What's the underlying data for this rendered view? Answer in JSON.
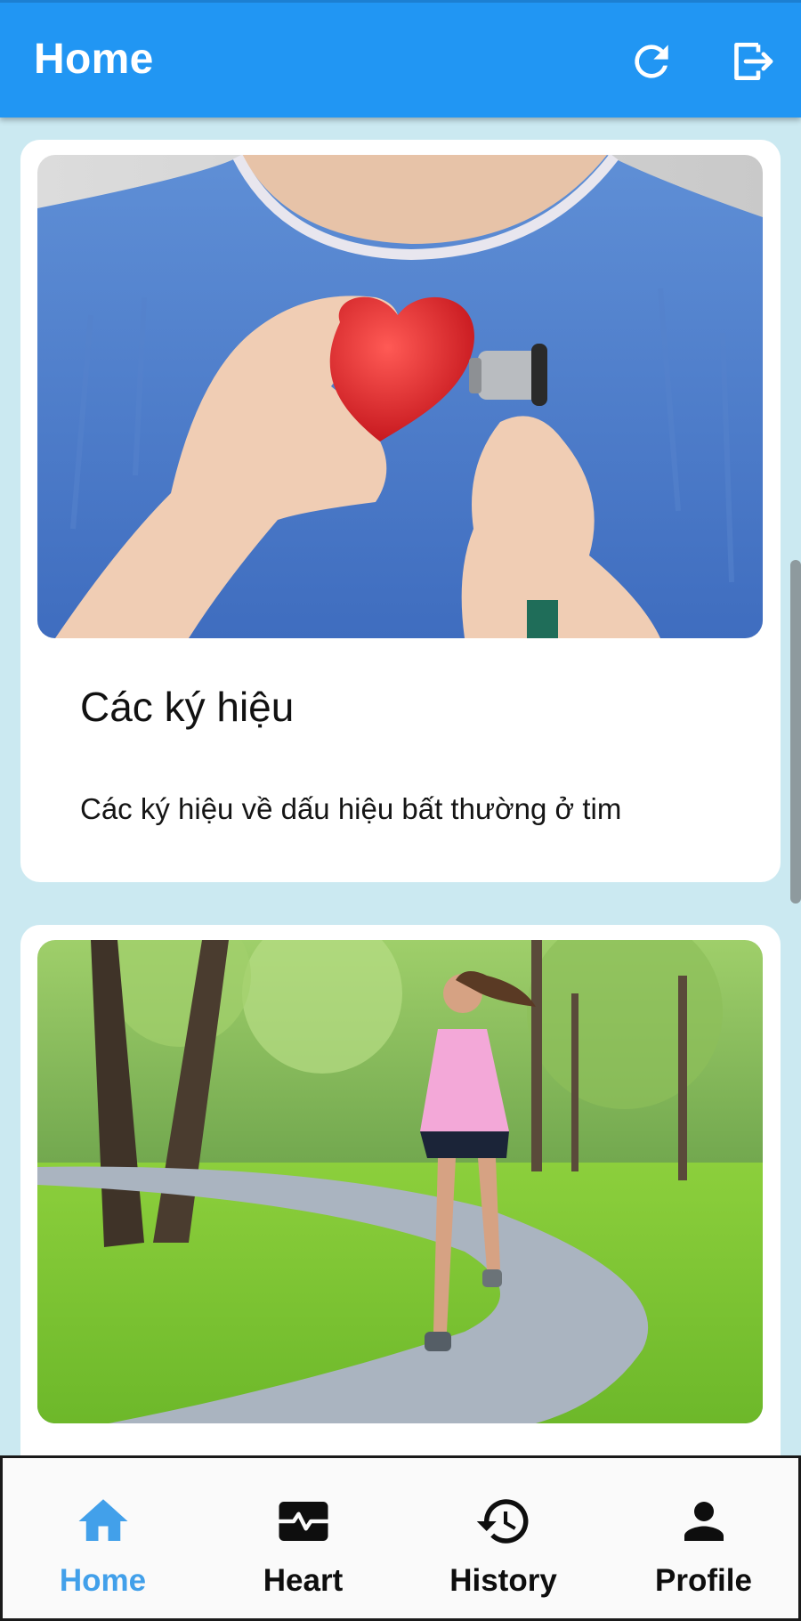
{
  "app_bar": {
    "title": "Home",
    "refresh_icon": "refresh-icon",
    "logout_icon": "logout-icon"
  },
  "cards": [
    {
      "image": "heart-stethoscope-photo",
      "title": "Các ký hiệu",
      "description": "Các ký hiệu về dấu hiệu bất thường ở tim"
    },
    {
      "image": "woman-running-in-park-photo"
    }
  ],
  "bottom_nav": {
    "items": [
      {
        "label": "Home",
        "icon": "home-icon",
        "active": true
      },
      {
        "label": "Heart",
        "icon": "heart-monitor-icon",
        "active": false
      },
      {
        "label": "History",
        "icon": "history-icon",
        "active": false
      },
      {
        "label": "Profile",
        "icon": "person-icon",
        "active": false
      }
    ]
  },
  "colors": {
    "primary": "#2196f3",
    "background": "#cbe9f1",
    "active_nav": "#42a0ea",
    "card": "#ffffff"
  }
}
